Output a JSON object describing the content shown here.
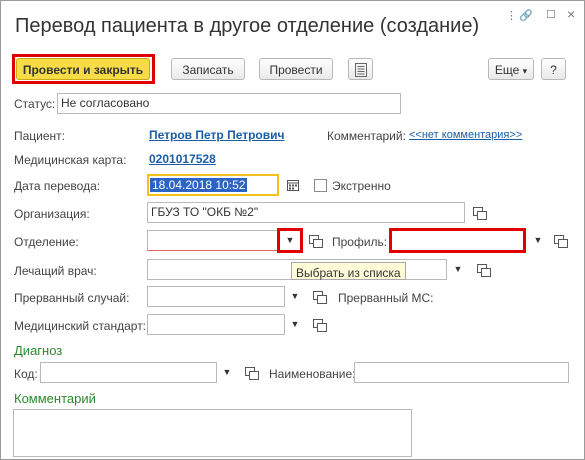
{
  "window": {
    "title": "Перевод пациента в другое отделение (создание)",
    "controls": {
      "menu": "⋮",
      "link": "🔗",
      "maximize": "☐",
      "close": "×"
    }
  },
  "toolbar": {
    "post_close": "Провести и закрыть",
    "save": "Записать",
    "post": "Провести",
    "more": "Еще",
    "more_arrow": "▾",
    "help": "?"
  },
  "form": {
    "status_label": "Статус:",
    "status_value": "Не согласовано",
    "patient_label": "Пациент:",
    "patient_value": "Петров Петр Петрович",
    "comment_label": "Комментарий:",
    "comment_link": "<<нет комментария>>",
    "card_label": "Медицинская карта:",
    "card_value": "0201017528",
    "date_label": "Дата перевода:",
    "date_value": "18.04.2018 10:52",
    "urgent_label": "Экстренно",
    "org_label": "Организация:",
    "org_value": "ГБУЗ ТО \"ОКБ №2\"",
    "dept_label": "Отделение:",
    "dept_value": "",
    "profile_label": "Профиль:",
    "profile_value": "",
    "doctor_label": "Лечащий врач:",
    "doctor_value": "",
    "case_label": "Прерванный случай:",
    "case_value": "",
    "ms_label": "Прерванный МС:",
    "standard_label": "Медицинский стандарт:",
    "standard_value": "",
    "dropdown_arrow": "▼"
  },
  "tooltip": "Выбрать из списка",
  "diagnosis": {
    "section": "Диагноз",
    "code_label": "Код:",
    "code_value": "",
    "name_label": "Наименование:",
    "name_value": ""
  },
  "comment_section": {
    "title": "Комментарий",
    "value": ""
  },
  "colors": {
    "accent": "#f7dc47",
    "highlight": "#e00000",
    "link": "#1a5ea8",
    "section": "#2a8a2a"
  }
}
